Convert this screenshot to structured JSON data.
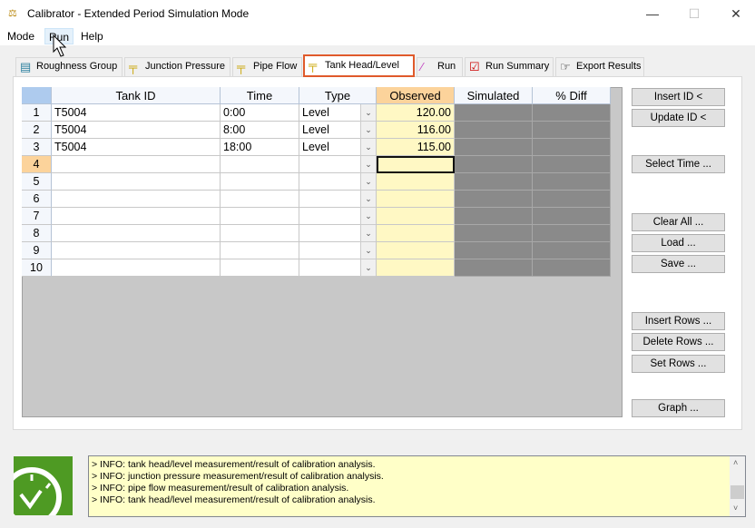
{
  "window": {
    "title": "Calibrator - Extended Period Simulation Mode",
    "min": "—",
    "max": "☐",
    "close": "✕"
  },
  "menu": [
    "Mode",
    "Run",
    "Help"
  ],
  "tabs": [
    {
      "label": "Roughness Group",
      "icon": "folder-icon"
    },
    {
      "label": "Junction Pressure",
      "icon": "gauge-icon"
    },
    {
      "label": "Pipe Flow",
      "icon": "gauge-icon"
    },
    {
      "label": "Tank Head/Level",
      "icon": "gauge-icon",
      "active": true
    },
    {
      "label": "Run",
      "icon": "pen-icon"
    },
    {
      "label": "Run Summary",
      "icon": "checklist-icon"
    },
    {
      "label": "Export Results",
      "icon": "pointing-hand-icon"
    }
  ],
  "grid": {
    "columns": [
      "Tank ID",
      "Time",
      "Type",
      "Observed",
      "Simulated",
      "% Diff"
    ],
    "rows": [
      {
        "n": "1",
        "id": "T5004",
        "time": "0:00",
        "type": "Level",
        "obs": "120.00"
      },
      {
        "n": "2",
        "id": "T5004",
        "time": "8:00",
        "type": "Level",
        "obs": "116.00"
      },
      {
        "n": "3",
        "id": "T5004",
        "time": "18:00",
        "type": "Level",
        "obs": "115.00"
      },
      {
        "n": "4",
        "id": "",
        "time": "",
        "type": "",
        "obs": ""
      },
      {
        "n": "5",
        "id": "",
        "time": "",
        "type": "",
        "obs": ""
      },
      {
        "n": "6",
        "id": "",
        "time": "",
        "type": "",
        "obs": ""
      },
      {
        "n": "7",
        "id": "",
        "time": "",
        "type": "",
        "obs": ""
      },
      {
        "n": "8",
        "id": "",
        "time": "",
        "type": "",
        "obs": ""
      },
      {
        "n": "9",
        "id": "",
        "time": "",
        "type": "",
        "obs": ""
      },
      {
        "n": "10",
        "id": "",
        "time": "",
        "type": "",
        "obs": ""
      }
    ],
    "selected_row": "4"
  },
  "buttons": {
    "insert_id": "Insert ID <",
    "update_id": "Update ID <",
    "select_time": "Select Time ...",
    "clear_all": "Clear All ...",
    "load": "Load ...",
    "save": "Save ...",
    "insert_rows": "Insert Rows ...",
    "delete_rows": "Delete Rows ...",
    "set_rows": "Set Rows ...",
    "graph": "Graph ..."
  },
  "log": [
    "> INFO: tank head/level measurement/result of calibration analysis.",
    "> INFO: junction pressure measurement/result of calibration analysis.",
    "> INFO: pipe flow measurement/result of calibration analysis.",
    "> INFO: tank head/level measurement/result of calibration analysis."
  ],
  "colors": {
    "observed": "#fff8c4",
    "clock": "#4e9a23",
    "active_tab_highlight": "#e05a2b"
  }
}
